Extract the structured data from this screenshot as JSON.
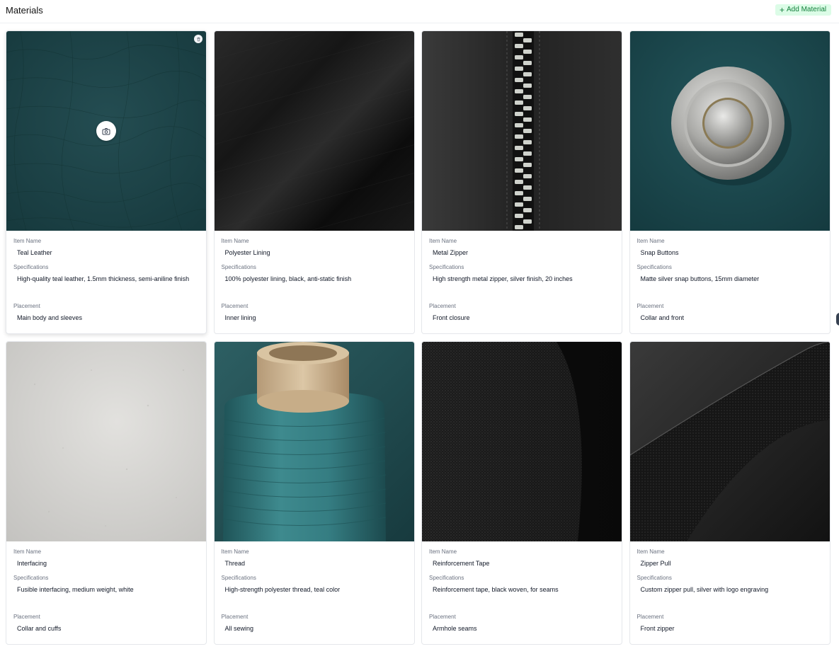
{
  "header": {
    "title": "Materials",
    "add_button_label": "Add Material"
  },
  "labels": {
    "item_name": "Item Name",
    "specifications": "Specifications",
    "placement": "Placement"
  },
  "materials": [
    {
      "item_name": "Teal Leather",
      "specifications": "High-quality teal leather, 1.5mm thickness, semi-aniline finish",
      "placement": "Main body and sleeves",
      "swatch_color": "#1d4347"
    },
    {
      "item_name": "Polyester Lining",
      "specifications": "100% polyester lining, black, anti-static finish",
      "placement": "Inner lining",
      "swatch_color": "#141414"
    },
    {
      "item_name": "Metal Zipper",
      "specifications": "High strength metal zipper, silver finish, 20 inches",
      "placement": "Front closure",
      "swatch_color": "#2a2a2a"
    },
    {
      "item_name": "Snap Buttons",
      "specifications": "Matte silver snap buttons, 15mm diameter",
      "placement": "Collar and front",
      "swatch_color": "#1b4a4f"
    },
    {
      "item_name": "Interfacing",
      "specifications": "Fusible interfacing, medium weight, white",
      "placement": "Collar and cuffs",
      "swatch_color": "#d6d5d2"
    },
    {
      "item_name": "Thread",
      "specifications": "High-strength polyester thread, teal color",
      "placement": "All sewing",
      "swatch_color": "#2f7377"
    },
    {
      "item_name": "Reinforcement Tape",
      "specifications": "Reinforcement tape, black woven, for seams",
      "placement": "Armhole seams",
      "swatch_color": "#1a1a1a"
    },
    {
      "item_name": "Zipper Pull",
      "specifications": "Custom zipper pull, silver with logo engraving",
      "placement": "Front zipper",
      "swatch_color": "#262626"
    }
  ]
}
